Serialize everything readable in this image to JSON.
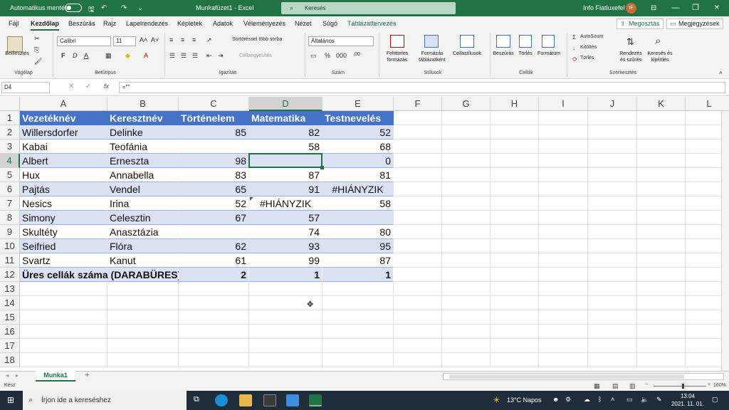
{
  "titlebar": {
    "autosave_label": "Automatikus mentés",
    "doc_title": "Munkafüzet1  -  Excel",
    "search_placeholder": "Keresés",
    "user_name": "Info Fiatluxefel",
    "user_initials": "IF",
    "btn_min": "—",
    "btn_max": "❐",
    "btn_close": "✕"
  },
  "menu": {
    "items": [
      "Fájl",
      "Kezdőlap",
      "Beszúrás",
      "Rajz",
      "Lapelrendezés",
      "Képletek",
      "Adatok",
      "Véleményezés",
      "Nézet",
      "Súgó",
      "Táblázattervezés"
    ],
    "share": "Megosztás",
    "comments": "Megjegyzések"
  },
  "ribbon": {
    "paste": "Beillesztés",
    "group_clipboard": "Vágólap",
    "font_name": "Calibri",
    "font_size": "11",
    "group_font": "Betűtípus",
    "bold": "F",
    "italic": "D",
    "underline": "A",
    "wrap": "Sortöréssel több sorba",
    "merge": "Cellaegyesítés",
    "group_align": "Igazítás",
    "number_format": "Általános",
    "group_number": "Szám",
    "cond_format": "Feltételes formázás",
    "table_format": "Formázás táblázatként",
    "cell_styles": "Cellastílusok",
    "group_styles": "Stílusok",
    "insert": "Beszúrás",
    "delete": "Törlés",
    "format": "Formátum",
    "group_cells": "Cellák",
    "autosum": "AutoSzum",
    "fill": "Kitöltés",
    "clear": "Törlés",
    "sort": "Rendezés és szűrés",
    "find": "Keresés és kijelölés",
    "group_edit": "Szerkesztés"
  },
  "formula": {
    "namebox": "D4",
    "content": "=\"\""
  },
  "grid": {
    "columns": [
      "A",
      "B",
      "C",
      "D",
      "E",
      "F",
      "G",
      "H",
      "I",
      "J",
      "K",
      "L"
    ],
    "rows": [
      "1",
      "2",
      "3",
      "4",
      "5",
      "6",
      "7",
      "8",
      "9",
      "10",
      "11",
      "12",
      "13",
      "14",
      "15",
      "16",
      "17",
      "18"
    ],
    "headers": [
      "Vezetéknév",
      "Keresztnév",
      "Történelem",
      "Matematika",
      "Testnevelés"
    ],
    "data": [
      [
        "Willersdorfer",
        "Delinke",
        "85",
        "82",
        "52"
      ],
      [
        "Kabai",
        "Teofánia",
        "",
        "58",
        "68"
      ],
      [
        "Albert",
        "Erneszta",
        "98",
        "",
        "0"
      ],
      [
        "Hux",
        "Annabella",
        "83",
        "87",
        "81"
      ],
      [
        "Pajtás",
        "Vendel",
        "65",
        "91",
        "#HIÁNYZIK"
      ],
      [
        "Nesics",
        "Irina",
        "52",
        "#HIÁNYZIK",
        "58"
      ],
      [
        "Simony",
        "Celesztin",
        "67",
        "57",
        ""
      ],
      [
        "Skultéty",
        "Anasztázia",
        "",
        "74",
        "80"
      ],
      [
        "Seifried",
        "Flóra",
        "62",
        "93",
        "95"
      ],
      [
        "Svartz",
        "Kanut",
        "61",
        "99",
        "87"
      ]
    ],
    "total_label": "Üres cellák száma (DARABÜRES):",
    "totals": [
      "2",
      "1",
      "1"
    ]
  },
  "sheet": {
    "tab": "Munka1",
    "add": "+"
  },
  "status": {
    "ready": "Kész",
    "zoom": "160%"
  },
  "taskbar": {
    "search_placeholder": "Írjon ide a kereséshez",
    "weather": "13°C  Napos",
    "time": "13:04",
    "date": "2021. 11. 01."
  },
  "colors": {
    "excel_green": "#217346",
    "table_header": "#4472c4",
    "table_band": "#d9e1f2"
  }
}
